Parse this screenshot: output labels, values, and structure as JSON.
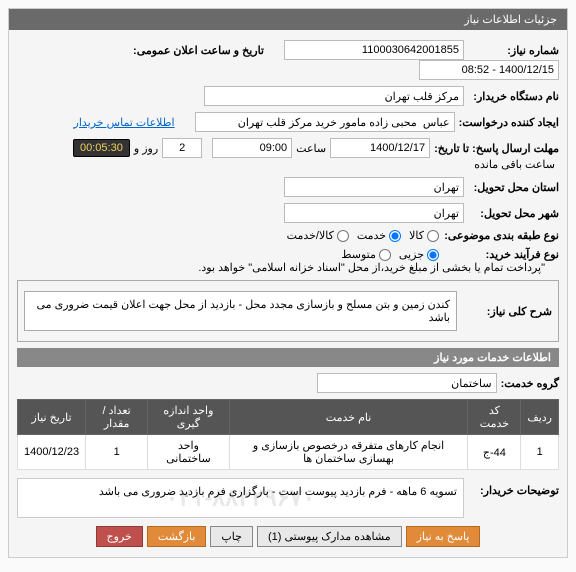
{
  "panel_title": "جزئیات اطلاعات نیاز",
  "fields": {
    "req_no_label": "شماره نیاز:",
    "req_no": "1100030642001855",
    "announce_label": "تاریخ و ساعت اعلان عمومی:",
    "announce": "1400/12/15 - 08:52",
    "buyer_org_label": "نام دستگاه خریدار:",
    "buyer_org": "مرکز قلب تهران",
    "creator_label": "ایجاد کننده درخواست:",
    "creator": "عباس  محبی زاده مامور خرید مرکز قلب تهران",
    "contact_link": "اطلاعات تماس خریدار",
    "deadline_label": "مهلت ارسال پاسخ: تا تاریخ:",
    "deadline_date": "1400/12/17",
    "time_word": "ساعت",
    "deadline_time": "09:00",
    "day_word": "روز و",
    "days_left": "2",
    "remain_label": "ساعت باقی مانده",
    "countdown": "00:05:30",
    "province_label": "استان محل تحویل:",
    "province": "تهران",
    "city_label": "شهر محل تحویل:",
    "city": "تهران",
    "subject_class_label": "نوع طبقه بندی موضوعی:",
    "radio_kala": "کالا",
    "radio_khadamat": "خدمت",
    "radio_kala_khadamat": "کالا/خدمت",
    "process_label": "نوع فرآیند خرید:",
    "radio_jozi": "جزیی",
    "radio_motavaset": "متوسط",
    "process_note": "\"پرداخت تمام یا بخشی از مبلغ خرید،از محل \"اسناد خزانه اسلامی\" خواهد بود.",
    "main_desc_label": "شرح کلی نیاز:",
    "main_desc": "کندن زمین و بتن مسلح و بازسازی مجدد محل - بازدید از محل جهت اعلان قیمت ضروری می باشد",
    "services_header": "اطلاعات خدمات مورد نیاز",
    "group_label": "گروه خدمت:",
    "group": "ساختمان"
  },
  "table": {
    "headers": [
      "ردیف",
      "کد خدمت",
      "نام خدمت",
      "واحد اندازه گیری",
      "تعداد / مقدار",
      "تاریخ نیاز"
    ],
    "rows": [
      [
        "1",
        "44-ج",
        "انجام کارهای متفرقه درخصوص بازسازی و بهسازی ساختمان ها",
        "واحد ساختمانی",
        "1",
        "1400/12/23"
      ]
    ]
  },
  "buyer_note_label": "توضیحات خریدار:",
  "buyer_note": "تسویه 6 ماهه - فرم بازدید پیوست است - بارگزاری فرم بازدید ضروری می باشد",
  "watermark": "۰۲۱-۸۸۳۲۹۶۷۰",
  "buttons": {
    "reply": "پاسخ به نیاز",
    "attachments": "مشاهده مدارک پیوستی (1)",
    "print": "چاپ",
    "back": "بازگشت",
    "exit": "خروج"
  }
}
